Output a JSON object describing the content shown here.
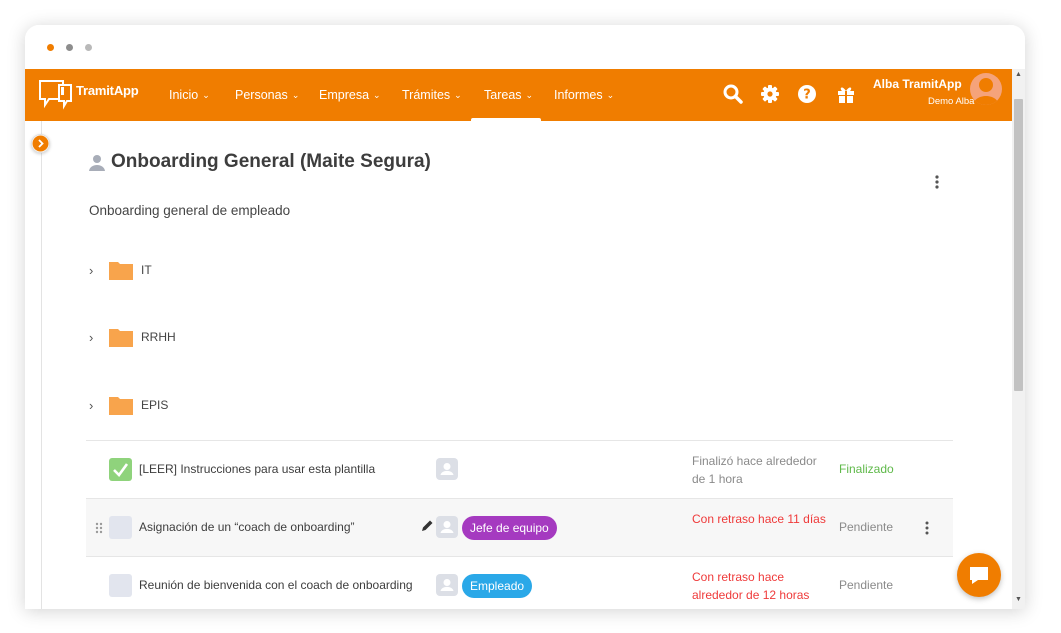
{
  "brand": {
    "name_part1": "Tramit",
    "name_part2": "App",
    "accent_color": "#f07d00"
  },
  "nav": {
    "items": [
      {
        "label": "Inicio"
      },
      {
        "label": "Personas"
      },
      {
        "label": "Empresa"
      },
      {
        "label": "Trámites"
      },
      {
        "label": "Tareas",
        "active": true
      },
      {
        "label": "Informes"
      }
    ],
    "icons": [
      "search-icon",
      "gear-icon",
      "help-icon",
      "gift-icon"
    ]
  },
  "user": {
    "name": "Alba TramitApp",
    "company": "Demo Alba"
  },
  "page": {
    "title": "Onboarding General (Maite Segura)",
    "subtitle": "Onboarding general de empleado"
  },
  "folders": [
    {
      "label": "IT"
    },
    {
      "label": "RRHH"
    },
    {
      "label": "EPIS"
    }
  ],
  "tasks": [
    {
      "title": "[LEER] Instrucciones para usar esta plantilla",
      "role": "",
      "due": "Finalizó hace alrededor de 1 hora",
      "status": "Finalizado",
      "done": true
    },
    {
      "title": "Asignación de un “coach de onboarding”",
      "role": "Jefe de equipo",
      "due": "Con retraso hace 11 días",
      "status": "Pendiente",
      "done": false
    },
    {
      "title": "Reunión de bienvenida con el coach de onboarding",
      "role": "Empleado",
      "due": "Con retraso hace alrededor de 12 horas",
      "status": "Pendiente",
      "done": false
    }
  ],
  "colors": {
    "role_purple": "#a53ac0",
    "role_blue": "#2aa8e8",
    "overdue_red": "#ef3a3a",
    "done_green": "#5fb94a",
    "folder_orange": "#f8a44c"
  }
}
